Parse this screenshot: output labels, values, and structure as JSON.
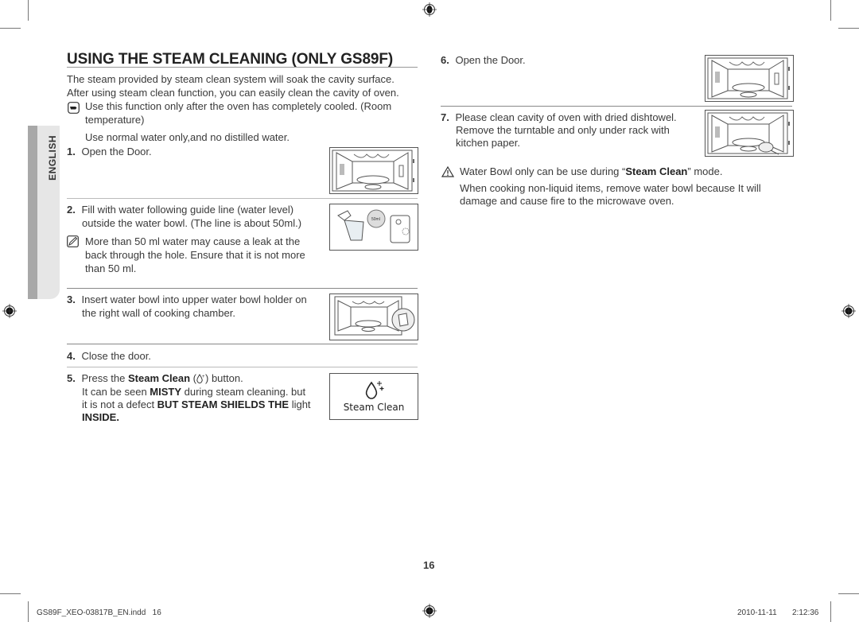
{
  "page": {
    "side_tab": "ENGLISH",
    "title": "USING THE STEAM CLEANING (ONLY GS89F)",
    "intro": [
      "The steam provided by steam clean system will soak the cavity surface.",
      "After using steam clean function, you can easily clean the cavity of oven."
    ],
    "note_icon": "pointing-hand-icon",
    "notes": [
      "Use this function only after the oven has completely cooled. (Room",
      "temperature)",
      "Use normal water only,and no distilled water."
    ],
    "steps": [
      {
        "num": "1.",
        "lines": [
          "Open the Door."
        ]
      },
      {
        "num": "2.",
        "lines": [
          "Fill with water following guide line (water level)",
          "outside the water bowl. (The line is about 50ml.)"
        ],
        "memo_icon": "memo-pencil-icon",
        "memo": [
          "More than 50 ml water may cause a leak at the",
          "back through the hole. Ensure that it is not more",
          "than 50 ml."
        ]
      },
      {
        "num": "3.",
        "lines": [
          "Insert water bowl into upper water bowl holder on",
          "the right wall of cooking chamber."
        ]
      },
      {
        "num": "4.",
        "lines": [
          "Close the door."
        ]
      },
      {
        "num": "5.",
        "line1_pre": "Press the ",
        "line1_bold": "Steam Clean",
        "line1_post": " (",
        "line1_end": ") button.",
        "line2_pre": "It can be seen ",
        "line2_bold": "MISTY",
        "line2_post": " during steam cleaning. but",
        "line3_pre": "it is not a defect ",
        "line3_bold": "BUT STEAM SHIELDS THE",
        "line3_post": " light",
        "line4_bold": "INSIDE."
      },
      {
        "num": "6.",
        "lines": [
          "Open the Door."
        ]
      },
      {
        "num": "7.",
        "lines": [
          "Please clean cavity of oven with dried dishtowel.",
          "Remove the turntable and only under rack with",
          "kitchen paper."
        ]
      }
    ],
    "steam_button_label": "Steam Clean",
    "water_label": "50ml",
    "caution_icon": "warning-triangle-icon",
    "caution_pre": "Water Bowl only can be use during “",
    "caution_bold": "Steam Clean",
    "caution_post": "” mode.",
    "caution_lines": [
      "When cooking non-liquid items, remove water bowl because It will",
      "damage and cause fire to the microwave oven."
    ],
    "page_number": "16",
    "footer_file": "GS89F_XEO-03817B_EN.indd   16",
    "footer_date": "2010-11-11",
    "footer_time": "2:12:36"
  }
}
